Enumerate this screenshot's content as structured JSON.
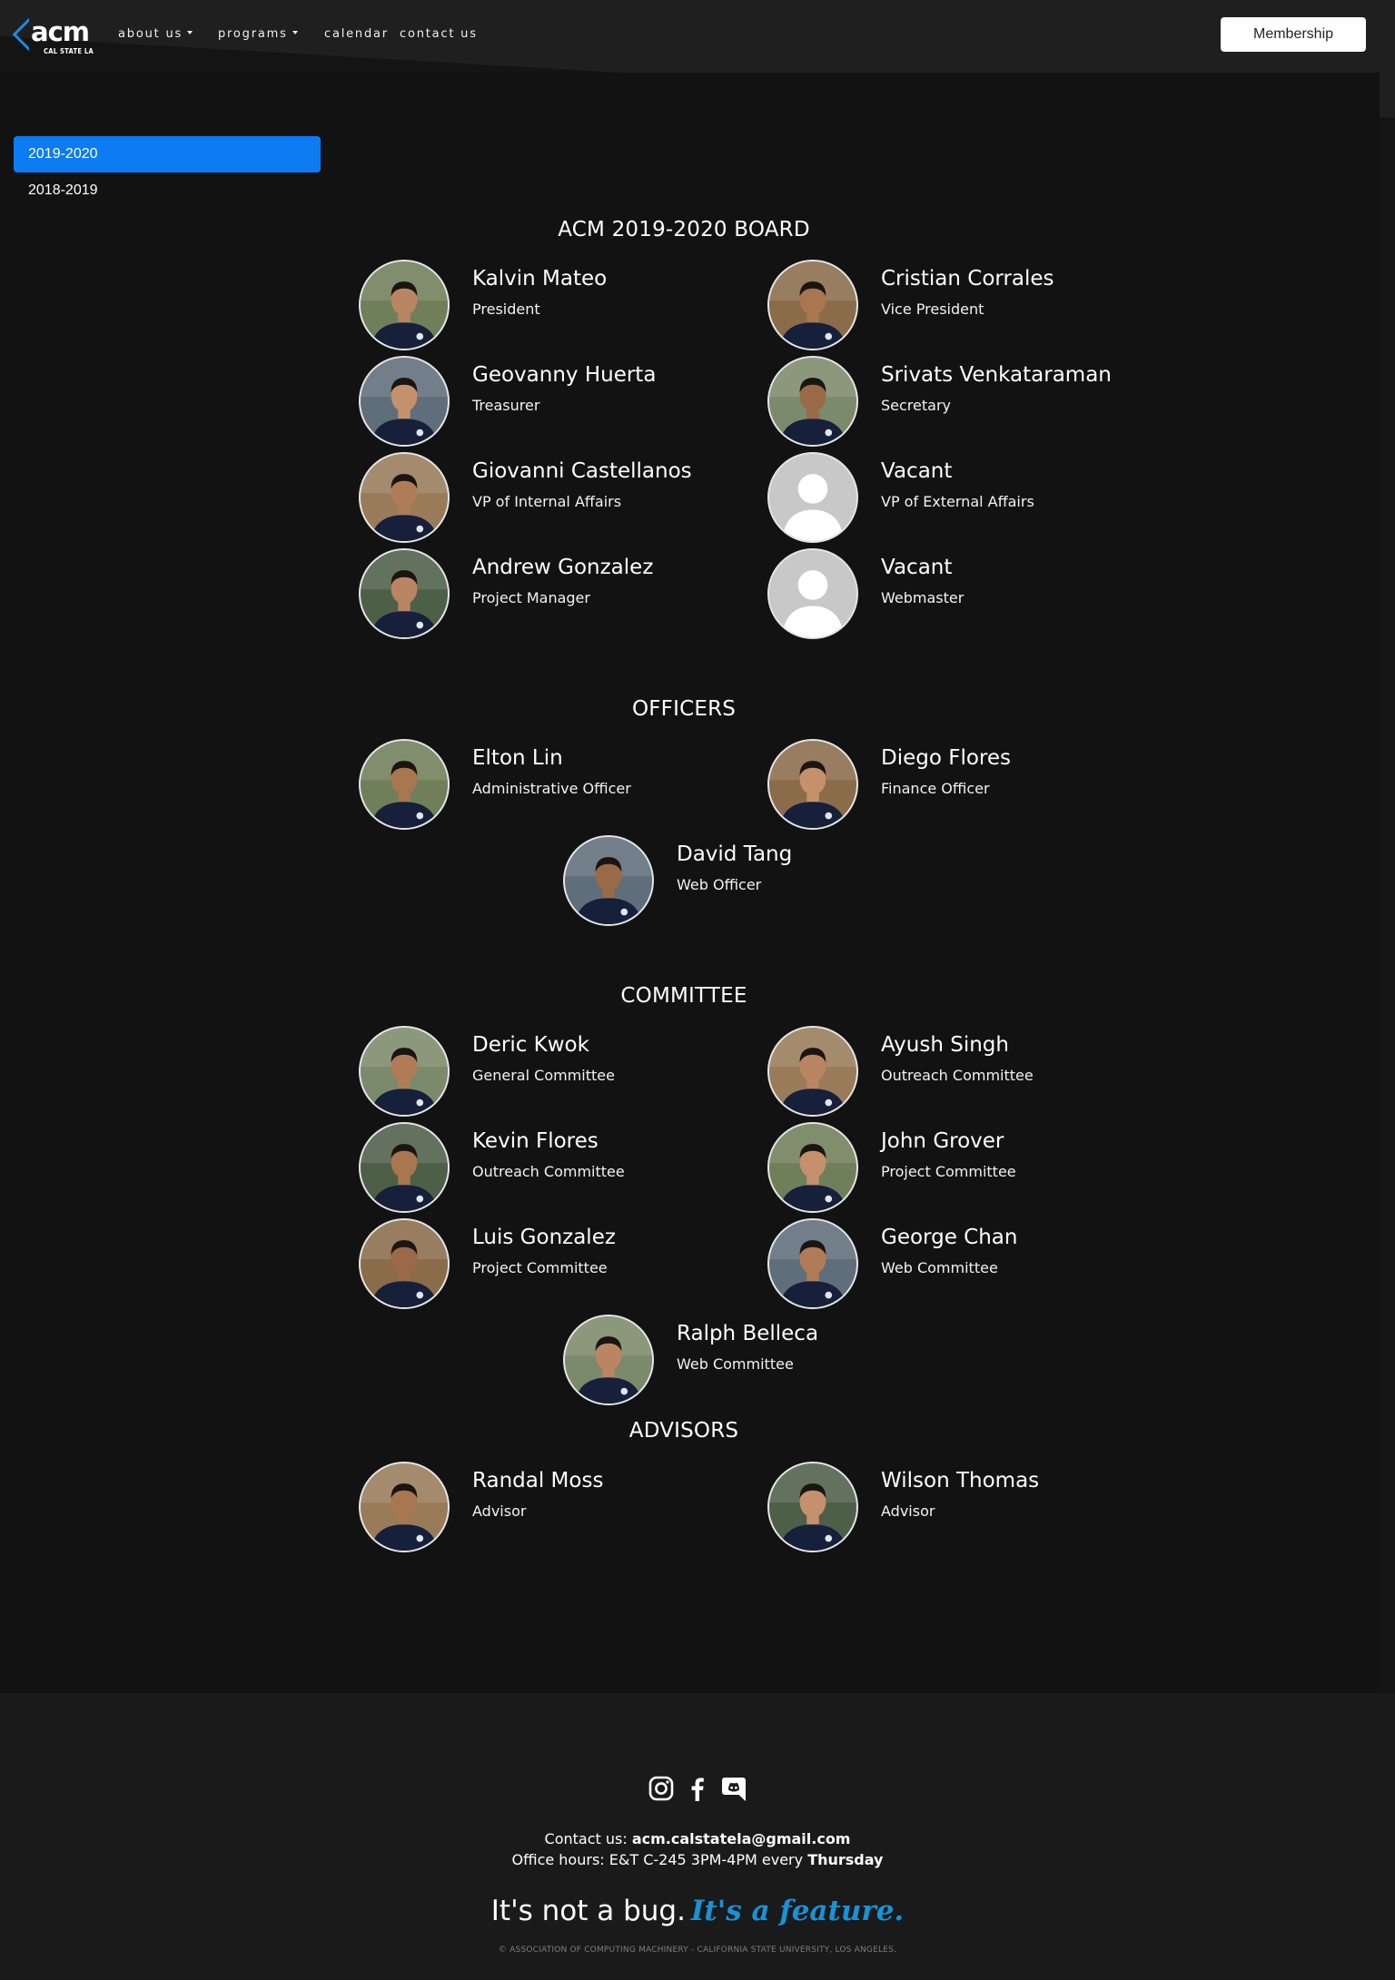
{
  "header": {
    "logo_text": "acm",
    "logo_subtext": "CAL STATE LA",
    "nav": [
      {
        "label": "about us",
        "dropdown": true
      },
      {
        "label": "programs",
        "dropdown": true
      },
      {
        "label": "calendar",
        "dropdown": false
      },
      {
        "label": "contact us",
        "dropdown": false
      }
    ],
    "membership_label": "Membership"
  },
  "years": [
    {
      "label": "2019-2020",
      "active": true
    },
    {
      "label": "2018-2019",
      "active": false
    }
  ],
  "sections": {
    "board": {
      "title": "ACM 2019-2020 BOARD",
      "members": [
        {
          "name": "Kalvin Mateo",
          "role": "President",
          "photo": "photo"
        },
        {
          "name": "Cristian Corrales",
          "role": "Vice President",
          "photo": "photo"
        },
        {
          "name": "Geovanny Huerta",
          "role": "Treasurer",
          "photo": "photo"
        },
        {
          "name": "Srivats Venkataraman",
          "role": "Secretary",
          "photo": "photo"
        },
        {
          "name": "Giovanni Castellanos",
          "role": "VP of Internal Affairs",
          "photo": "photo"
        },
        {
          "name": "Vacant",
          "role": "VP of External Affairs",
          "photo": "placeholder"
        },
        {
          "name": "Andrew Gonzalez",
          "role": "Project Manager",
          "photo": "photo"
        },
        {
          "name": "Vacant",
          "role": "Webmaster",
          "photo": "placeholder"
        }
      ]
    },
    "officers": {
      "title": "OFFICERS",
      "members": [
        {
          "name": "Elton Lin",
          "role": "Administrative Officer",
          "photo": "photo"
        },
        {
          "name": "Diego Flores",
          "role": "Finance Officer",
          "photo": "photo"
        },
        {
          "name": "David Tang",
          "role": "Web Officer",
          "photo": "photo"
        }
      ]
    },
    "committee": {
      "title": "COMMITTEE",
      "members": [
        {
          "name": "Deric Kwok",
          "role": "General Committee",
          "photo": "photo"
        },
        {
          "name": "Ayush Singh",
          "role": "Outreach Committee",
          "photo": "photo"
        },
        {
          "name": "Kevin Flores",
          "role": "Outreach Committee",
          "photo": "photo"
        },
        {
          "name": "John Grover",
          "role": "Project Committee",
          "photo": "photo"
        },
        {
          "name": "Luis Gonzalez",
          "role": "Project Committee",
          "photo": "photo"
        },
        {
          "name": "George Chan",
          "role": "Web Committee",
          "photo": "photo"
        },
        {
          "name": "Ralph Belleca",
          "role": "Web Committee",
          "photo": "photo"
        }
      ]
    },
    "advisors": {
      "title": "ADVISORS",
      "members": [
        {
          "name": "Randal Moss",
          "role": "Advisor",
          "photo": "photo"
        },
        {
          "name": "Wilson Thomas",
          "role": "Advisor",
          "photo": "photo"
        }
      ]
    }
  },
  "footer": {
    "social_icons": [
      "instagram-icon",
      "facebook-icon",
      "discord-icon"
    ],
    "contact_prefix": "Contact us: ",
    "contact_email": "acm.calstatela@gmail.com",
    "hours_prefix": "Office hours: E&T C-245 3PM-4PM every ",
    "hours_day": "Thursday",
    "motto_plain": "It's not a bug.",
    "motto_accent": "It's a feature.",
    "copyright": "© ASSOCIATION OF COMPUTING MACHINERY - CALIFORNIA STATE UNIVERSITY, LOS ANGELES."
  },
  "colors": {
    "accent_blue": "#0d7bf2",
    "motto_blue": "#1792d8",
    "page_bg": "#141414",
    "header_bg": "#1e1e1e"
  }
}
